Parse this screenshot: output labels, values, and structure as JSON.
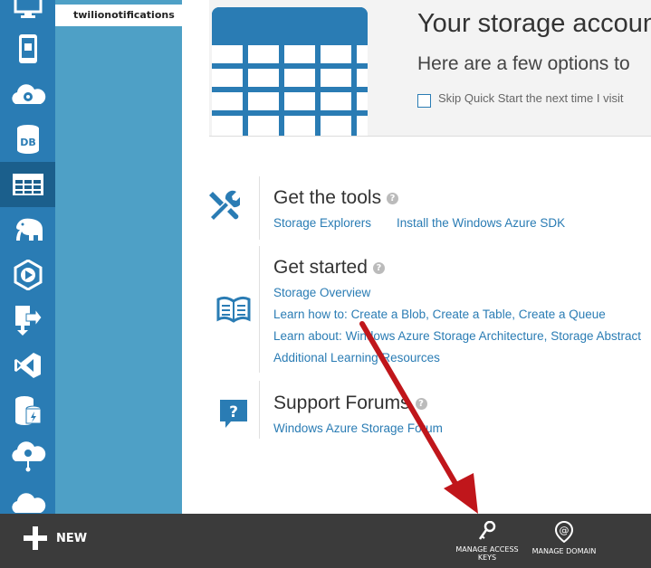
{
  "subnav": {
    "item": "twilionotifications"
  },
  "hero": {
    "title": "Your storage account",
    "subtitle": "Here are a few options to",
    "skip_label": "Skip Quick Start the next time I visit"
  },
  "sections": [
    {
      "title": "Get the tools",
      "icon": "tools-icon",
      "links": [
        "Storage Explorers",
        "Install the Windows Azure SDK"
      ]
    },
    {
      "title": "Get started",
      "icon": "book-icon",
      "lines": [
        {
          "prefix": "",
          "links": [
            "Storage Overview"
          ]
        },
        {
          "prefix": "Learn how to: ",
          "links": [
            "Create a Blob,",
            "Create a Table,",
            "Create a Queue"
          ]
        },
        {
          "prefix": "Learn about: ",
          "links": [
            "Windows Azure Storage Architecture,",
            "Storage Abstract"
          ]
        },
        {
          "prefix": "",
          "links": [
            "Additional Learning Resources"
          ]
        }
      ]
    },
    {
      "title": "Support Forums",
      "icon": "forum-icon",
      "links": [
        "Windows Azure Storage Forum"
      ]
    }
  ],
  "bottombar": {
    "new_label": "NEW",
    "manage_keys_line1": "MANAGE ACCESS",
    "manage_keys_line2": "KEYS",
    "manage_domain": "MANAGE DOMAIN"
  },
  "colors": {
    "accent": "#2a7cb4",
    "nav": "#2a7cb4",
    "subnav": "#4ea0c6",
    "bar": "#3b3b3b",
    "arrow": "#c0161b"
  }
}
